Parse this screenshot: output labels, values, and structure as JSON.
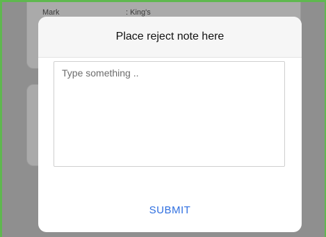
{
  "background": {
    "row_label": "Mark",
    "row_value": ": King's"
  },
  "modal": {
    "title": "Place reject note here",
    "note_placeholder": "Type something ..",
    "note_value": "",
    "submit_label": "SUBMIT"
  },
  "colors": {
    "accent": "#2f6fe0",
    "frame_border": "#5fb84f",
    "overlay": "#8f8f8f"
  }
}
